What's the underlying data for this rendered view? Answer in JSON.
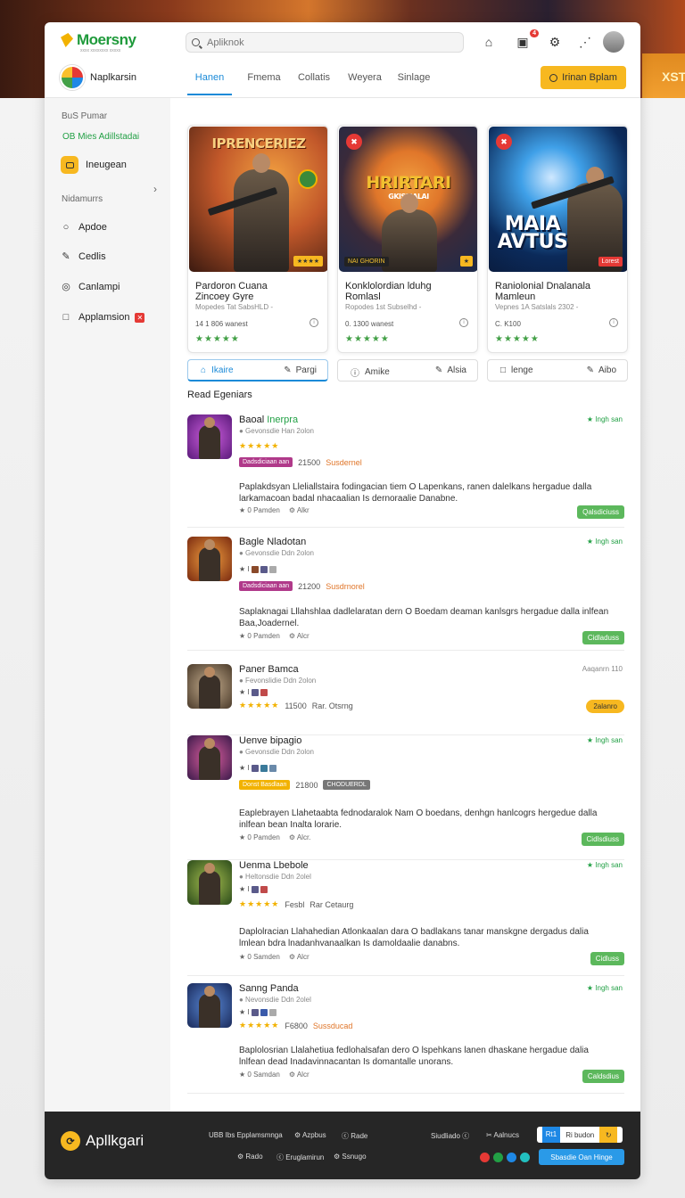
{
  "brand": {
    "name": "Moersny",
    "tagline": "xxxx xxxxxxxx xxxxx"
  },
  "search": {
    "placeholder": "Apliknok"
  },
  "header": {
    "notif_count": "4",
    "user_name": "Naplkarsin",
    "cta_label": "Irinan Bplam"
  },
  "tabs": [
    "Hanen",
    "Fmema",
    "Collatis",
    "Weyera",
    "Sinlage"
  ],
  "sidebar": {
    "section1": "BuS Pumar",
    "green_item": "OB Mies Adillstadai",
    "active_item": "Ineugean",
    "section2": "Nidamurrs",
    "items": [
      {
        "label": "Apdoe",
        "icon": "circle-icon"
      },
      {
        "label": "Cedlis",
        "icon": "pen-icon"
      },
      {
        "label": "Canlampi",
        "icon": "camera-icon"
      },
      {
        "label": "Applamsion",
        "icon": "square-icon",
        "badge": "✕"
      }
    ]
  },
  "featured": [
    {
      "art_title": "IPRENCERIEZ",
      "tag": "★★★★",
      "title": "Pardoron Cuana\nZincoey Gyre",
      "meta": "Mopedes Tat SabsHLD -",
      "downloads": "14 1 806 wanest",
      "stars": "★★★★★",
      "colors": [
        "#3b1a10",
        "#c2582a",
        "#f2a040"
      ]
    },
    {
      "art_title": "HRIRTARI",
      "art_sub": "GKISMALAI",
      "badge": "✖",
      "tag_left": "NAI GHORIN",
      "title": "Konklolordian lduhg\nRomlasl",
      "meta": "Ropodes 1st Subselhd -",
      "downloads": "0. 1300 wanest",
      "stars": "★★★★★",
      "colors": [
        "#1c2a4a",
        "#e0762a",
        "#3a2a3a"
      ]
    },
    {
      "art_title": "MAIA AVTUS",
      "badge": "✖",
      "tag": "Lorest",
      "title": "Raniolonial Dnalanala\nMamleun",
      "meta": "Vepnes 1A Satslals 2302 -",
      "downloads": "C. K100",
      "stars": "★★★★★",
      "colors": [
        "#0b2a5a",
        "#3fa0e8",
        "#0a1a3a"
      ]
    }
  ],
  "actions": [
    {
      "left": "Ikaire",
      "right": "Pargi",
      "left_icon": "home-icon",
      "right_icon": "pen-icon"
    },
    {
      "left": "Amike",
      "right": "Alsia",
      "left_icon": "info-icon",
      "right_icon": "pen-icon"
    },
    {
      "left": "lenge",
      "right": "Aibo",
      "left_icon": "square-icon",
      "right_icon": "pen-icon"
    }
  ],
  "list_title": "Read Egeniars",
  "rows": [
    {
      "name": "Baoal",
      "name_green": "Inerpra",
      "dev": "● Gevonsdie Han 2olon",
      "stars": "★★★★★",
      "pill": "Dadsdiciaan aan",
      "pill_color": "#b03a8a",
      "count": "21500",
      "status": "Susdernel",
      "right": "★ Ingh san",
      "desc": "Paplakdsyan Lleliallstaira fodingacian tiem O Lapenkans, ranen dalelkans hergadue dalla larkamacoan badal nhacaalian Is dernoraalie Danabne.",
      "foot1": "★ 0 Pamden",
      "foot2": "⚙ Alkr",
      "btn": "Qalsdiciuss"
    },
    {
      "name": "Bagle Nladotan",
      "dev": "● Gevonsdie Ddn 2olon",
      "pill": "Dadsdiciaan aan",
      "pill_color": "#b03a8a",
      "count": "21200",
      "status": "Susdrnorel",
      "right": "★ Ingh san",
      "desc": "Saplaknagai Lllahshlaa dadlelaratan dern O Boedam deaman kanlsgrs hergadue dalla inlfean Baa,Joadernel.",
      "foot1": "★ 0 Pamden",
      "foot2": "⚙ Alcr",
      "btn": "Cidladuss"
    },
    {
      "name": "Paner Bamca",
      "dev": "● Fevonslidie Ddn 2olon",
      "stars": "★★★★★",
      "count": "11500",
      "status": "Rar. Otsrng",
      "right": "Aaqanrn 110",
      "right_gray": true,
      "btn": "2alanro",
      "btn_orange": true
    },
    {
      "name": "Uenve bipagio",
      "dev": "● Gevonsdie Ddn 2olon",
      "pill": "Donst Basdlaan",
      "pill_color": "#f2b200",
      "count": "21800",
      "status": "CHODUERDL",
      "right": "★ Ingh san",
      "desc": "Eaplebrayen Llahetaabta fednodaralok Nam O boedans, denhgn hanlcogrs hergedue dalla inlfean bean Inalta lorarie.",
      "foot1": "★ 0 Pamden",
      "foot2": "⚙ Alcr.",
      "btn": "Cidlsdiuss"
    },
    {
      "name": "Uenma Lbebole",
      "dev": "● Heltonsdie Ddn 2olel",
      "stars": "★★★★★",
      "count": "Fesbl",
      "status": "Rar Cetaurg",
      "right": "★ Ingh san",
      "desc": "Daplolracian Llahahedian Atlonkaalan dara O badlakans tanar manskgne dergadus dalia lmlean bdra lnadanhvanaalkan Is damoldaalie danabns.",
      "foot1": "★ 0 Samden",
      "foot2": "⚙ Alcr",
      "btn": "Cidluss"
    },
    {
      "name": "Sanng Panda",
      "dev": "● Nevonsdie Ddn 2olel",
      "stars": "★★★★★",
      "count": "F6800",
      "status": "Sussducad",
      "right": "★ Ingh san",
      "desc": "Baplolosrian Llalahetiua fedlohalsafan dero O lspehkans lanen dhaskane hergadue dalia lnlfean dead Inadavinnacantan Is domantalle unorans.",
      "foot1": "★ 0 Samdan",
      "foot2": "⚙ Alcr",
      "btn": "Caldsdius"
    }
  ],
  "footer": {
    "brand": "Apllkgari",
    "links1": [
      "UBB Ibs Epplamsmnga",
      "⚙ Azpbus",
      "ⓒ Rade"
    ],
    "links2": [
      "⚙ Rado",
      "ⓒ Eruglamirun",
      "⚙ Ssnugo"
    ],
    "right_label": "Siudliado ⓒ",
    "right_link": "✂ Aalnucs",
    "btn1_left": "Rt1",
    "btn1_right": "Ri budon",
    "btn2": "Sbasdie Oan Hinge"
  },
  "colors": {
    "accent": "#f7b820",
    "green": "#22a045",
    "blue": "#1a8ad8",
    "red": "#e53935"
  }
}
